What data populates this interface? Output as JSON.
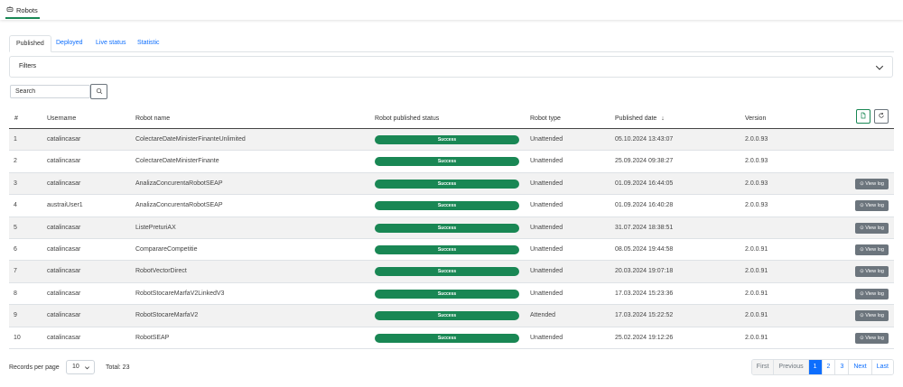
{
  "app_tab": {
    "label": "Robots"
  },
  "tabs": [
    "Published",
    "Deployed",
    "Live status",
    "Statistic"
  ],
  "filters": {
    "label": "Filters"
  },
  "search": {
    "placeholder": "Search"
  },
  "table": {
    "headers": {
      "num": "#",
      "username": "Username",
      "robot_name": "Robot name",
      "status": "Robot published status",
      "type": "Robot type",
      "date": "Published date",
      "version": "Version"
    },
    "sort_icon": "arrow-down-icon",
    "rows": [
      {
        "num": "1",
        "username": "catalincasar",
        "robot_name": "ColectareDateMinisterFinanteUnlimited",
        "status": "Success",
        "type": "Unattended",
        "date": "05.10.2024 13:43:07",
        "version": "2.0.0.93",
        "view_log": ""
      },
      {
        "num": "2",
        "username": "catalincasar",
        "robot_name": "ColectareDateMinisterFinante",
        "status": "Success",
        "type": "Unattended",
        "date": "25.09.2024 09:38:27",
        "version": "2.0.0.93",
        "view_log": ""
      },
      {
        "num": "3",
        "username": "catalincasar",
        "robot_name": "AnalizaConcurentaRobotSEAP",
        "status": "Success",
        "type": "Unattended",
        "date": "01.09.2024 16:44:05",
        "version": "2.0.0.93",
        "view_log": "View log"
      },
      {
        "num": "4",
        "username": "austraiUser1",
        "robot_name": "AnalizaConcurentaRobotSEAP",
        "status": "Success",
        "type": "Unattended",
        "date": "01.09.2024 16:40:28",
        "version": "2.0.0.93",
        "view_log": "View log"
      },
      {
        "num": "5",
        "username": "catalincasar",
        "robot_name": "ListePreturiAX",
        "status": "Success",
        "type": "Unattended",
        "date": "31.07.2024 18:38:51",
        "version": "",
        "view_log": "View log"
      },
      {
        "num": "6",
        "username": "catalincasar",
        "robot_name": "ComparareCompetitie",
        "status": "Success",
        "type": "Unattended",
        "date": "08.05.2024 19:44:58",
        "version": "2.0.0.91",
        "view_log": "View log"
      },
      {
        "num": "7",
        "username": "catalincasar",
        "robot_name": "RobotVectorDirect",
        "status": "Success",
        "type": "Unattended",
        "date": "20.03.2024 19:07:18",
        "version": "2.0.0.91",
        "view_log": "View log"
      },
      {
        "num": "8",
        "username": "catalincasar",
        "robot_name": "RobotStocareMarfaV2LinkedV3",
        "status": "Success",
        "type": "Unattended",
        "date": "17.03.2024 15:23:36",
        "version": "2.0.0.91",
        "view_log": "View log"
      },
      {
        "num": "9",
        "username": "catalincasar",
        "robot_name": "RobotStocareMarfaV2",
        "status": "Success",
        "type": "Attended",
        "date": "17.03.2024 15:22:52",
        "version": "2.0.0.91",
        "view_log": "View log"
      },
      {
        "num": "10",
        "username": "catalincasar",
        "robot_name": "RobotSEAP",
        "status": "Success",
        "type": "Unattended",
        "date": "25.02.2024 19:12:26",
        "version": "2.0.0.91",
        "view_log": "View log"
      }
    ]
  },
  "footer": {
    "records_label": "Records per page",
    "records_value": "10",
    "total": "Total: 23",
    "pager": [
      "First",
      "Previous",
      "1",
      "2",
      "3",
      "Next",
      "Last"
    ],
    "active_page": "1"
  },
  "colors": {
    "success": "#198754",
    "primary": "#0d6efd",
    "secondary": "#6c757d"
  }
}
